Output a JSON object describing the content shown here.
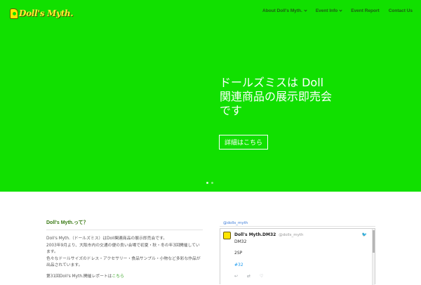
{
  "brand": {
    "logo_text": "Doll's Myth.",
    "hero_color": "#11e000"
  },
  "nav": {
    "items": [
      {
        "label": "About Doll's Myth.",
        "has_dropdown": true
      },
      {
        "label": "Event Info",
        "has_dropdown": true
      },
      {
        "label": "Event Report",
        "has_dropdown": false
      },
      {
        "label": "Contact Us",
        "has_dropdown": false
      }
    ]
  },
  "hero": {
    "lines": [
      "ドールズミスは Doll",
      "関連商品の展示即売会",
      "です"
    ],
    "button_label": "詳細はこちら",
    "slides_total": 2,
    "slide_active": 1
  },
  "about": {
    "title": "Doll's Myth.って？",
    "paragraphs": [
      "Doll's Myth.（ドールズミス）はDoll関連商品の展示即売会です。",
      "2003年9月より、大阪市内の交通の便の良い会場で初夏・秋・冬の年3回開催しています。",
      "色々なドールサイズのドレス・アクセサリー・食品サンプル・小物など多彩な作品が出品されています。"
    ],
    "report_prefix": "第31回Doll's Myth.開催レポートは",
    "report_link": "こちら"
  },
  "twitter": {
    "handle_label": "@dolls_myth",
    "tweet": {
      "name": "Doll's Myth.DM32",
      "handle": "@dolls_myth",
      "line1": "DM32",
      "line2": "2SP",
      "hashtag": "#32"
    }
  }
}
